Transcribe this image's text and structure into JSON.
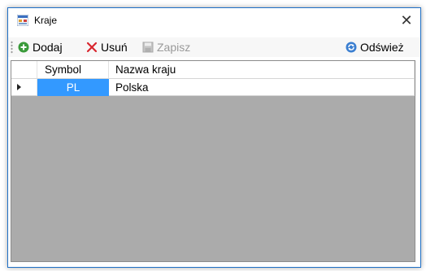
{
  "window": {
    "title": "Kraje",
    "close_glyph": "✕"
  },
  "toolbar": {
    "add_label": "Dodaj",
    "delete_label": "Usuń",
    "save_label": "Zapisz",
    "refresh_label": "Odśwież"
  },
  "grid": {
    "columns": [
      "Symbol",
      "Nazwa kraju"
    ],
    "rows": [
      {
        "symbol": "PL",
        "name": "Polska"
      }
    ]
  },
  "colors": {
    "selection": "#3399ff",
    "grid_background": "#ababab",
    "add_icon": "#3a9a3a",
    "delete_icon": "#d8262e",
    "refresh_icon": "#3b7fd1"
  },
  "icons": {
    "window": "window-icon",
    "add": "add-icon",
    "delete": "delete-icon",
    "save": "save-icon",
    "refresh": "refresh-icon",
    "current_row": "current-row-arrow-icon"
  }
}
